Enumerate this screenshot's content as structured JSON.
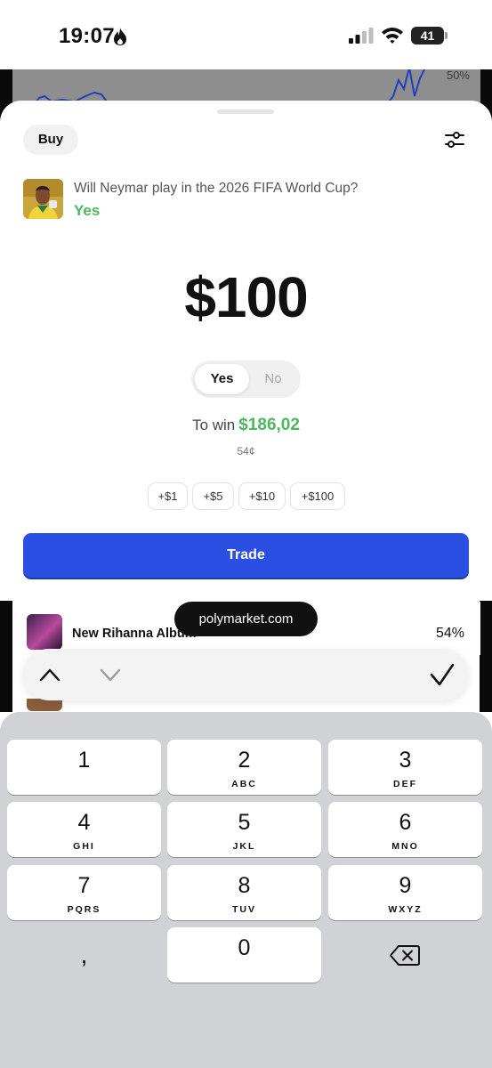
{
  "status_bar": {
    "time": "19:07",
    "battery": "41"
  },
  "background_page": {
    "chart_percent": "50%"
  },
  "sheet": {
    "mode_label": "Buy",
    "market": {
      "question": "Will Neymar play in the 2026 FIFA World Cup?",
      "outcome": "Yes"
    },
    "amount": "$100",
    "toggle": {
      "yes": "Yes",
      "no": "No",
      "selected": "Yes"
    },
    "to_win_label": "To win",
    "to_win_value": "$186,02",
    "price": "54¢",
    "quick_amounts": [
      "+$1",
      "+$5",
      "+$10",
      "+$100"
    ],
    "trade_label": "Trade"
  },
  "list": {
    "item_title": "New Rihanna Album",
    "item_percent": "54%"
  },
  "browser": {
    "url": "polymarket.com"
  },
  "keypad": {
    "keys": [
      {
        "digit": "1",
        "letters": ""
      },
      {
        "digit": "2",
        "letters": "ABC"
      },
      {
        "digit": "3",
        "letters": "DEF"
      },
      {
        "digit": "4",
        "letters": "GHI"
      },
      {
        "digit": "5",
        "letters": "JKL"
      },
      {
        "digit": "6",
        "letters": "MNO"
      },
      {
        "digit": "7",
        "letters": "PQRS"
      },
      {
        "digit": "8",
        "letters": "TUV"
      },
      {
        "digit": "9",
        "letters": "WXYZ"
      },
      {
        "digit": "0",
        "letters": ""
      }
    ],
    "decimal_key": ","
  },
  "colors": {
    "accent_blue": "#2b4fe3",
    "yes_green": "#4cb85c",
    "keypad_bg": "#d1d2d6"
  }
}
